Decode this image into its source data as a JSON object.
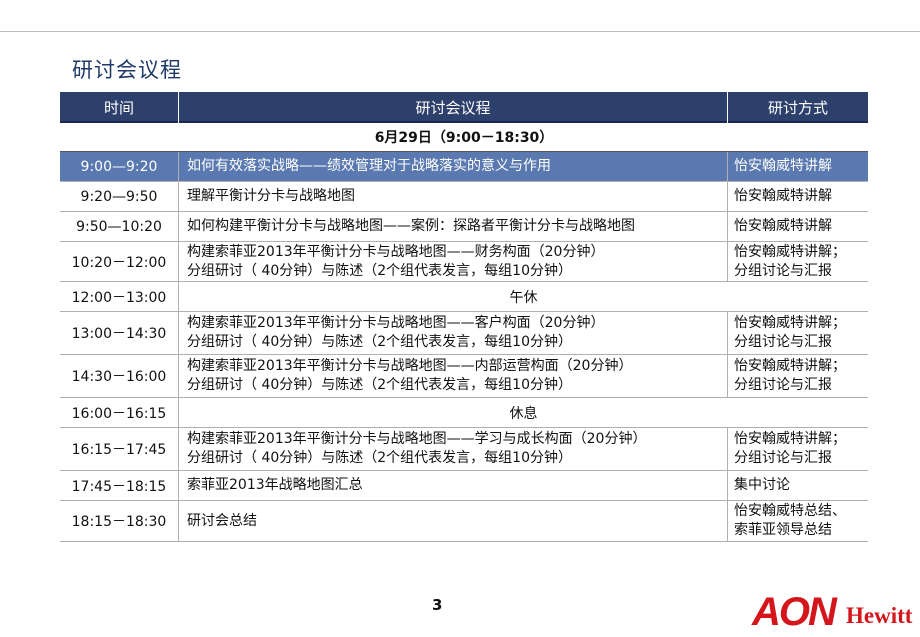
{
  "title": "研讨会议程",
  "table": {
    "headers": [
      "时间",
      "研讨会议程",
      "研讨方式"
    ],
    "date_row": "6月29日（9:00－18:30）",
    "rows": [
      {
        "time": "9:00—9:20",
        "content": [
          "如何有效落实战略——绩效管理对于战略落实的意义与作用"
        ],
        "method": [
          "怡安翰威特讲解"
        ],
        "highlight": true
      },
      {
        "time": "9:20—9:50",
        "content": [
          "理解平衡计分卡与战略地图"
        ],
        "method": [
          "怡安翰威特讲解"
        ]
      },
      {
        "time": "9:50—10:20",
        "content": [
          "如何构建平衡计分卡与战略地图——案例：探路者平衡计分卡与战略地图"
        ],
        "method": [
          "怡安翰威特讲解"
        ]
      },
      {
        "time": "10:20－12:00",
        "content": [
          "构建索菲亚2013年平衡计分卡与战略地图——财务构面（20分钟）",
          "分组研讨（ 40分钟）与陈述（2个组代表发言，每组10分钟）"
        ],
        "method": [
          "怡安翰威特讲解；",
          "分组讨论与汇报"
        ]
      },
      {
        "time": "12:00－13:00",
        "break": "午休"
      },
      {
        "time": "13:00－14:30",
        "content": [
          "构建索菲亚2013年平衡计分卡与战略地图——客户构面（20分钟）",
          "分组研讨（ 40分钟）与陈述（2个组代表发言，每组10分钟）"
        ],
        "method": [
          "怡安翰威特讲解；",
          "分组讨论与汇报"
        ]
      },
      {
        "time": "14:30－16:00",
        "content": [
          "构建索菲亚2013年平衡计分卡与战略地图——内部运营构面（20分钟）",
          "分组研讨（ 40分钟）与陈述（2个组代表发言，每组10分钟）"
        ],
        "method": [
          "怡安翰威特讲解；",
          "分组讨论与汇报"
        ]
      },
      {
        "time": "16:00－16:15",
        "break": "休息"
      },
      {
        "time": "16:15－17:45",
        "content": [
          "构建索菲亚2013年平衡计分卡与战略地图——学习与成长构面（20分钟）",
          "分组研讨（ 40分钟）与陈述（2个组代表发言，每组10分钟）"
        ],
        "method": [
          "怡安翰威特讲解；",
          "分组讨论与汇报"
        ]
      },
      {
        "time": "17:45－18:15",
        "content": [
          "索菲亚2013年战略地图汇总"
        ],
        "method": [
          "集中讨论"
        ]
      },
      {
        "time": "18:15－18:30",
        "content": [
          "研讨会总结"
        ],
        "method": [
          "怡安翰威特总结、",
          "索菲亚领导总结"
        ]
      }
    ]
  },
  "page_number": "3",
  "logo": {
    "aon": "AON",
    "hewitt": "Hewitt"
  }
}
